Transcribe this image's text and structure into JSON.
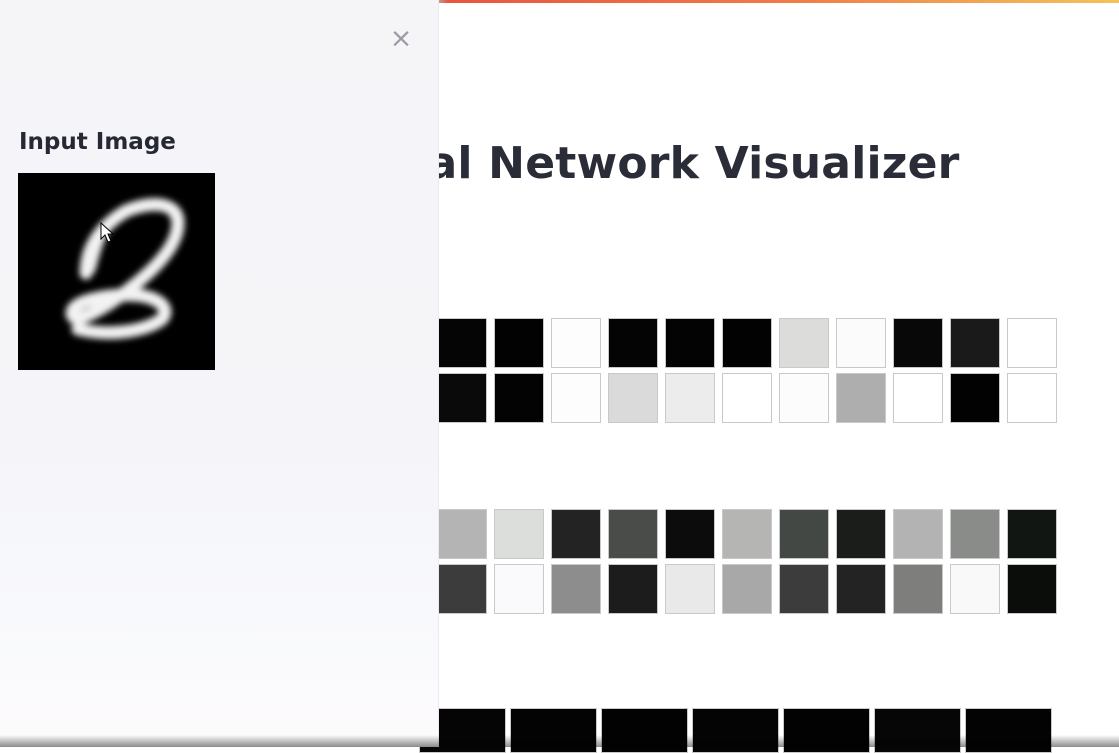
{
  "page": {
    "title": "Neural Network Visualizer",
    "accent_gradient": [
      "#e8563f",
      "#f07a48",
      "#f3c35a"
    ]
  },
  "sidebar": {
    "heading": "Input Image",
    "close_label": "×",
    "close_icon": "close-icon",
    "input_digit": "2"
  },
  "layers": [
    {
      "name": "layer-1",
      "rows": [
        [
          "#050505",
          "#020202",
          "#fdfdfd",
          "#040404",
          "#030303",
          "#020202",
          "#dcdddb",
          "#fbfbfb",
          "#070807",
          "#1a1a1a",
          "#ffffff"
        ],
        [
          "#0a0a0a",
          "#030303",
          "#fdfdfd",
          "#dadada",
          "#ececec",
          "#ffffff",
          "#fcfcfc",
          "#aeaeae",
          "#ffffff",
          "#020202",
          "#ffffff"
        ]
      ]
    },
    {
      "name": "layer-2",
      "rows": [
        [
          "#b4b4b4",
          "#dcdedc",
          "#232323",
          "#4a4c4a",
          "#0c0c0c",
          "#b5b6b4",
          "#444845",
          "#1a1d1a",
          "#b3b3b3",
          "#8a8c89",
          "#121612"
        ],
        [
          "#3c3c3c",
          "#fafafc",
          "#8d8d8d",
          "#1c1c1c",
          "#e9e9ea",
          "#a8a8a8",
          "#3c3c3c",
          "#232323",
          "#7e7f7c",
          "#f9f9f9",
          "#0a0d0a"
        ]
      ]
    },
    {
      "name": "output-layer",
      "rows": [
        [
          "#050505",
          "#030303",
          "#020202",
          "#040404",
          "#020202",
          "#060606",
          "#030303"
        ]
      ]
    }
  ]
}
